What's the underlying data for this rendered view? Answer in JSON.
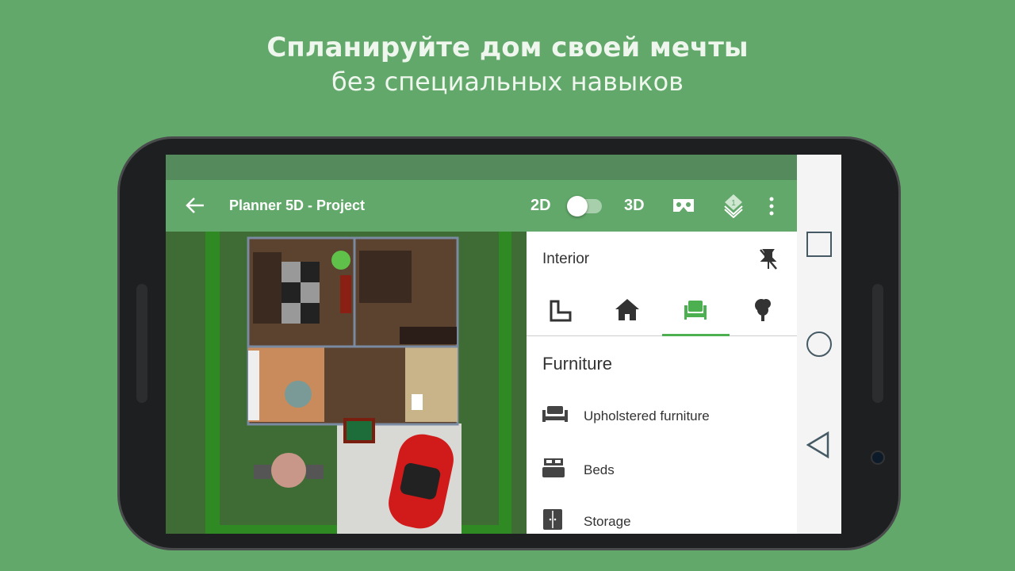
{
  "headline": {
    "title": "Спланируйте дом своей мечты",
    "subtitle": "без специальных навыков"
  },
  "toolbar": {
    "back_icon": "arrow-left-icon",
    "title": "Planner 5D - Project",
    "mode_2d": "2D",
    "mode_3d": "3D",
    "toggle_on_3d": false,
    "vr_icon": "cardboard-vr-icon",
    "layers_icon": "layers-icon",
    "layers_badge": "1",
    "more_icon": "more-vertical-icon"
  },
  "panel": {
    "title": "Interior",
    "pin_icon": "pin-off-icon",
    "tabs": [
      {
        "icon": "room-shape-icon"
      },
      {
        "icon": "house-icon"
      },
      {
        "icon": "armchair-icon",
        "active": true
      },
      {
        "icon": "tree-icon"
      }
    ],
    "section": "Furniture",
    "items": [
      {
        "label": "Upholstered furniture",
        "icon": "sofa-icon"
      },
      {
        "label": "Beds",
        "icon": "bed-icon"
      },
      {
        "label": "Storage",
        "icon": "wardrobe-icon"
      }
    ]
  },
  "colors": {
    "background": "#62a86a",
    "status_bar": "#558b5c",
    "accent": "#4caf50"
  },
  "nav": {
    "recent": "square-icon",
    "home": "circle-icon",
    "back": "triangle-back-icon"
  }
}
